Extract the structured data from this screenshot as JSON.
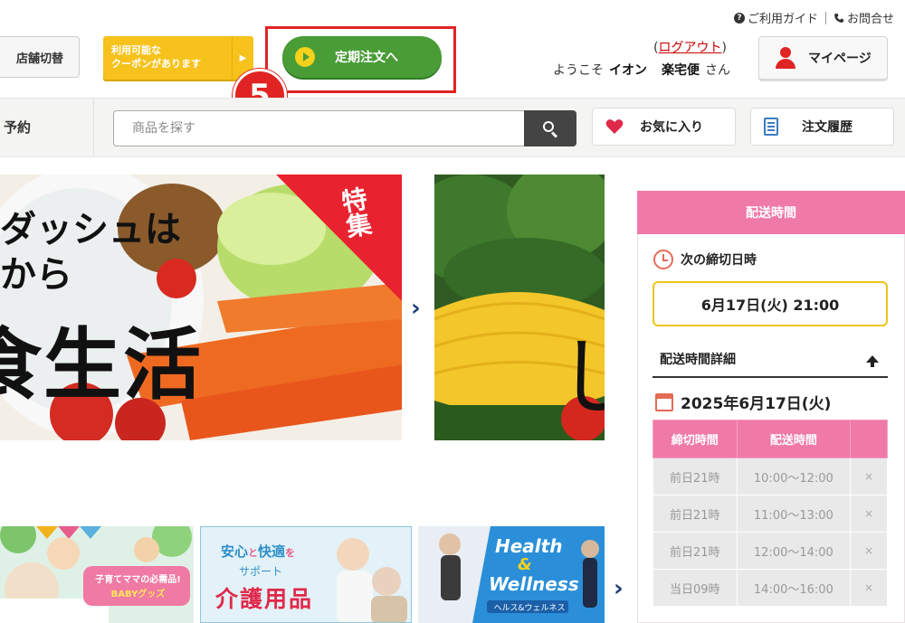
{
  "header": {
    "guide_label": "ご利用ガイド",
    "contact_label": "お問合せ",
    "store_switch_label": "店舗切替",
    "coupon_line1": "利用可能な",
    "coupon_line2": "クーポンがあります",
    "teiki_label": "定期注文へ",
    "step_number": "5",
    "logout_open": "(",
    "logout_label": "ログアウト",
    "logout_close": ")",
    "welcome_prefix": "ようこそ",
    "user_name": "イオン",
    "user_name2": "楽宅便",
    "welcome_suffix": "さん",
    "mypage_label": "マイページ"
  },
  "nav": {
    "reserve_label": "予約",
    "search_placeholder": "商品を探す",
    "favorites_label": "お気に入り",
    "history_label": "注文履歴"
  },
  "banner": {
    "line1": "ダッシュは",
    "line2": "から",
    "line3": "食生活",
    "tag": "特集",
    "banner2_char": "し"
  },
  "small_banners": {
    "baby_line1": "子育てママの必需品!",
    "baby_line2": "BABYグッズ",
    "care_line1a": "安心",
    "care_line1b": "と",
    "care_line1c": "快適",
    "care_line1d": "を",
    "care_line2": "サポート",
    "care_line3": "介護用品",
    "health_line1": "Health",
    "health_line2": "&",
    "health_line3": "Wellness",
    "health_line4": "ヘルス&ウェルネス"
  },
  "delivery": {
    "title": "配送時間",
    "next_deadline_label": "次の締切日時",
    "next_deadline_value": "6月17日(火) 21:00",
    "detail_label": "配送時間詳細",
    "date": "2025年6月17日(火)",
    "columns": [
      "締切時間",
      "配送時間",
      ""
    ],
    "rows": [
      [
        "前日21時",
        "10:00〜12:00",
        "×"
      ],
      [
        "前日21時",
        "11:00〜13:00",
        "×"
      ],
      [
        "前日21時",
        "12:00〜14:00",
        "×"
      ],
      [
        "当日09時",
        "14:00〜16:00",
        "×"
      ]
    ]
  },
  "colors": {
    "accent_pink": "#ef79a7",
    "teiki_green": "#4a9c37",
    "coupon_yellow": "#f6c21b",
    "highlight_red": "#e02424"
  }
}
